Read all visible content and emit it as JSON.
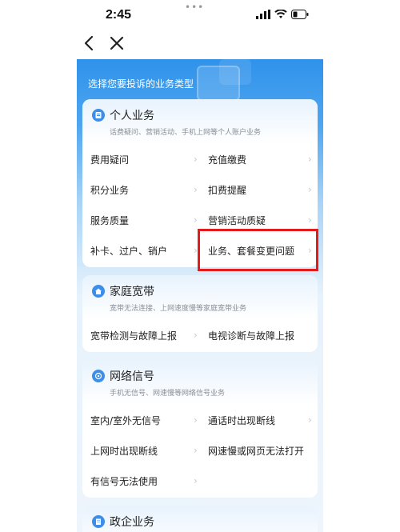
{
  "status": {
    "time": "2:45",
    "dots": "•••"
  },
  "heading": "选择您要投诉的业务类型",
  "cards": [
    {
      "title": "个人业务",
      "subtitle": "话费疑问、营销活动、手机上网等个人账户业务",
      "rows": [
        [
          "费用疑问",
          "充值缴费"
        ],
        [
          "积分业务",
          "扣费提醒"
        ],
        [
          "服务质量",
          "营销活动质疑"
        ],
        [
          "补卡、过户、销户",
          "业务、套餐变更问题"
        ]
      ]
    },
    {
      "title": "家庭宽带",
      "subtitle": "宽带无法连接、上网速度慢等家庭宽带业务",
      "rows": [
        [
          "宽带检测与故障上报",
          "电视诊断与故障上报"
        ]
      ]
    },
    {
      "title": "网络信号",
      "subtitle": "手机无信号、网速慢等网络信号业务",
      "rows": [
        [
          "室内/室外无信号",
          "通话时出现断线"
        ],
        [
          "上网时出现断线",
          "网速慢或网页无法打开"
        ],
        [
          "有信号无法使用",
          ""
        ]
      ]
    },
    {
      "title": "政企业务",
      "subtitle": "",
      "rows": []
    }
  ],
  "chevron": "›"
}
